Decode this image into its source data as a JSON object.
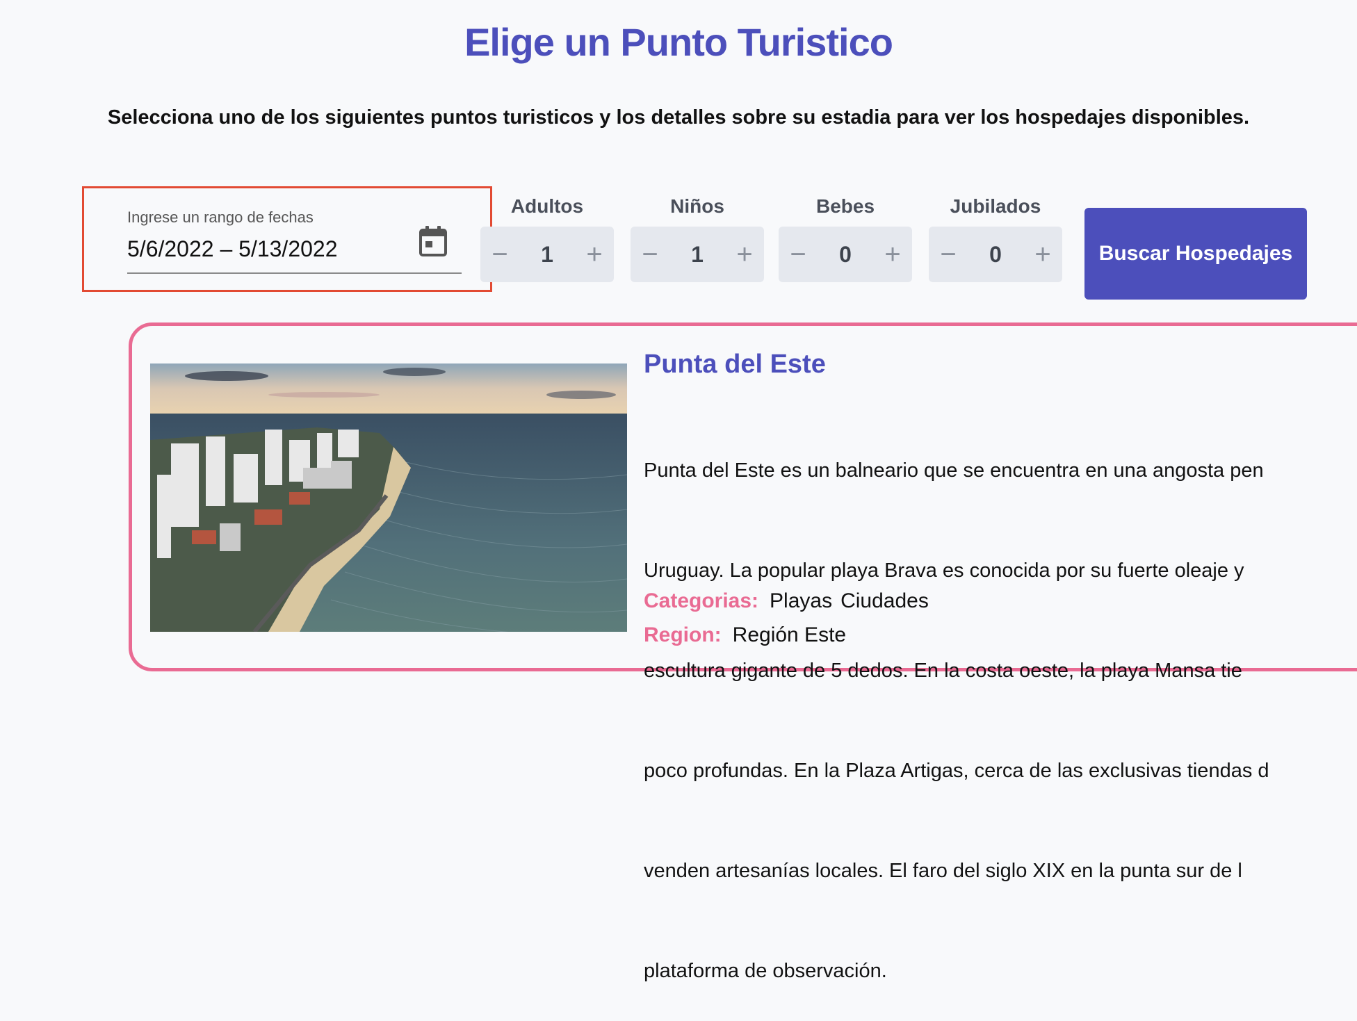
{
  "header": {
    "title": "Elige un Punto Turistico",
    "subtitle": "Selecciona uno de los siguientes puntos turisticos y los detalles sobre su estadia para ver los hospedajes disponibles."
  },
  "date_picker": {
    "label": "Ingrese un rango de fechas",
    "value": "5/6/2022 – 5/13/2022",
    "icon": "calendar-icon"
  },
  "counters": [
    {
      "label": "Adultos",
      "value": "1"
    },
    {
      "label": "Niños",
      "value": "1"
    },
    {
      "label": "Bebes",
      "value": "0"
    },
    {
      "label": "Jubilados",
      "value": "0"
    }
  ],
  "counter_symbols": {
    "minus": "−",
    "plus": "+"
  },
  "search_button": {
    "label": "Buscar Hospedajes"
  },
  "card": {
    "title": "Punta del Este",
    "description_lines": [
      "Punta del Este es un balneario que se encuentra en una angosta pen",
      "Uruguay. La popular playa Brava es conocida por su fuerte oleaje y",
      "escultura gigante de 5 dedos. En la costa oeste, la playa Mansa tie",
      "poco profundas. En la Plaza Artigas, cerca de las exclusivas tiendas d",
      "venden artesanías locales. El faro del siglo XIX en la punta sur de l",
      "plataforma de observación."
    ],
    "categories_label": "Categorias:",
    "categories": [
      "Playas",
      "Ciudades"
    ],
    "region_label": "Region:",
    "region": "Región Este"
  },
  "colors": {
    "accent": "#4c4fbb",
    "pink": "#e96b93",
    "highlight_border": "#e24a33"
  }
}
